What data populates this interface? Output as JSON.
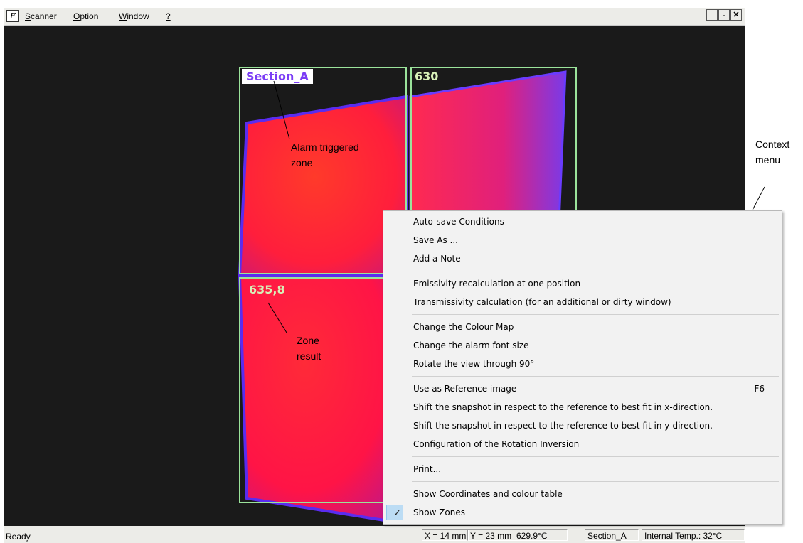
{
  "menubar": {
    "app_icon": "F",
    "items": [
      {
        "first": "S",
        "rest": "canner"
      },
      {
        "first": "O",
        "rest": "ption"
      },
      {
        "first": "W",
        "rest": "indow"
      },
      {
        "first": "?",
        "rest": ""
      }
    ],
    "window_controls": [
      "_",
      "▫",
      "✕"
    ]
  },
  "zones": {
    "section_a": "Section_A",
    "top_right": "630",
    "bottom_left": "635,8"
  },
  "annotations": {
    "alarm_line1": "Alarm triggered",
    "alarm_line2": "zone",
    "zone_result_line1": "Zone",
    "zone_result_line2": "result",
    "context_line1": "Context",
    "context_line2": "menu"
  },
  "context_menu": {
    "items": [
      {
        "label": "Auto-save Conditions"
      },
      {
        "label": "Save As ..."
      },
      {
        "label": "Add a Note"
      },
      {
        "label": "Emissivity recalculation at one position"
      },
      {
        "label": "Transmissivity calculation (for an additional or dirty window)"
      },
      {
        "label": "Change the Colour Map"
      },
      {
        "label": "Change the alarm font size"
      },
      {
        "label": "Rotate the view through 90°"
      },
      {
        "label": "Use as Reference image",
        "shortcut": "F6"
      },
      {
        "label": "Shift the snapshot in respect to the reference to best fit in x-direction."
      },
      {
        "label": "Shift the snapshot in respect to the reference to best fit in y-direction."
      },
      {
        "label": "Configuration of the Rotation Inversion"
      },
      {
        "label": "Print..."
      },
      {
        "label": "Show Coordinates and colour table"
      },
      {
        "label": "Show Zones",
        "checked": true
      }
    ]
  },
  "statusbar": {
    "ready": "Ready",
    "x": "X = 14 mm",
    "y": "Y = 23 mm",
    "temp": "629.9°C",
    "section": "Section_A",
    "internal_temp": "Internal Temp.: 32°C"
  },
  "colors": {
    "hot": "#ff1e32",
    "cool_edge": "#6a3cff",
    "zone_border": "#9be39b",
    "menu_check": "#bcdcf4"
  }
}
